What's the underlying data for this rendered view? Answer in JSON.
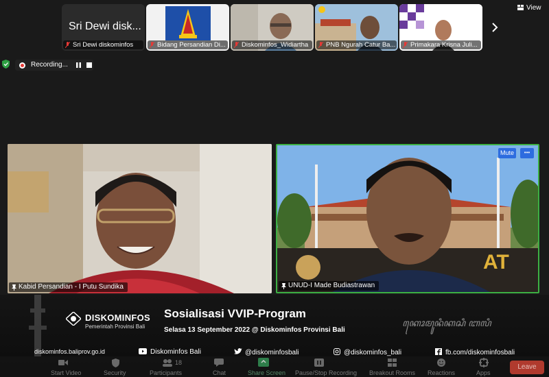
{
  "top_strip": {
    "tiles": [
      {
        "name": "Sri Dewi diskominfos",
        "display_text": "Sri Dewi disk..."
      },
      {
        "name": "Bidang Persandian Di..."
      },
      {
        "name": "Diskominfos_Widiartha"
      },
      {
        "name": "PNB Ngurah Catur Ba..."
      },
      {
        "name": "Primakara Krisna Juli..."
      }
    ],
    "view_label": "View"
  },
  "recording": {
    "label": "Recording..."
  },
  "videos": {
    "left": {
      "name": "Kabid Persandian - I Putu Sundika"
    },
    "right": {
      "name": "UNUD-I Made Budiastrawan",
      "mute_label": "Mute",
      "more_label": "•••",
      "sign_text": "AT"
    }
  },
  "banner": {
    "org_name": "DISKOMINFOS",
    "org_sub": "Pemerintah Provinsi Bali",
    "event_title": "Sosialisasi VVIP-Program",
    "event_subtitle": "Selasa 13 September 2022 @ Diskominfos Provinsi Bali",
    "balinese_script": "ꦏꦺꦴꦩꦸꦤꦶꦏꦱꦶ ꦧꦭꦶ"
  },
  "footer": {
    "website": "diskominfos.baliprov.go.id",
    "youtube": "Diskominfos Bali",
    "twitter": "@diskominfosbali",
    "instagram": "@diskominfos_bali",
    "facebook": "fb.com/diskominfosbali"
  },
  "toolbar": {
    "items": [
      "Start Video",
      "Security",
      "Participants",
      "Chat",
      "Share Screen",
      "Pause/Stop Recording",
      "Breakout Rooms",
      "Reactions",
      "Apps"
    ],
    "participants_count": "18",
    "leave_label": "Leave"
  },
  "colors": {
    "active_speaker": "#3cb043",
    "leave": "#c0392b",
    "mute_button": "#2d6cdf"
  }
}
